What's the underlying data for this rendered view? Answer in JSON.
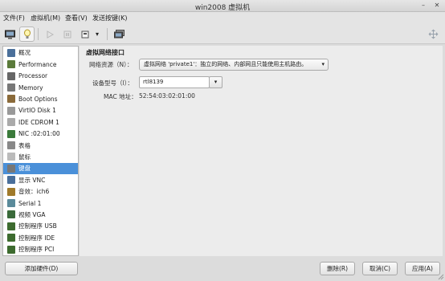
{
  "window": {
    "title": "win2008 虚拟机"
  },
  "menubar": [
    "文件(F)",
    "虚拟机(M)",
    "查看(V)",
    "发送按键(K)"
  ],
  "toolbar": {
    "buttons": [
      "console-icon",
      "info-icon",
      "run-icon",
      "pause-icon",
      "shutdown-icon",
      "dropdown-arrow-icon",
      "snapshot-icon"
    ],
    "dropdown_glyph": "▾"
  },
  "sidebar": {
    "selected_index": 10,
    "items": [
      {
        "label": "概况",
        "icon": "overview-icon"
      },
      {
        "label": "Performance",
        "icon": "performance-icon"
      },
      {
        "label": "Processor",
        "icon": "processor-icon"
      },
      {
        "label": "Memory",
        "icon": "memory-icon"
      },
      {
        "label": "Boot Options",
        "icon": "boot-options-icon"
      },
      {
        "label": "VirtIO Disk 1",
        "icon": "disk-icon"
      },
      {
        "label": "IDE CDROM 1",
        "icon": "cdrom-icon"
      },
      {
        "label": "NIC :02:01:00",
        "icon": "nic-icon"
      },
      {
        "label": "表格",
        "icon": "tablet-icon"
      },
      {
        "label": "鼠标",
        "icon": "mouse-icon"
      },
      {
        "label": "键盘",
        "icon": "keyboard-icon"
      },
      {
        "label": "显示 VNC",
        "icon": "display-icon"
      },
      {
        "label": "音效：ich6",
        "icon": "sound-icon"
      },
      {
        "label": "Serial 1",
        "icon": "serial-icon"
      },
      {
        "label": "视频 VGA",
        "icon": "video-icon"
      },
      {
        "label": "控制程序 USB",
        "icon": "controller-icon"
      },
      {
        "label": "控制程序 IDE",
        "icon": "controller-icon"
      },
      {
        "label": "控制程序 PCI",
        "icon": "controller-icon"
      }
    ]
  },
  "details": {
    "section_title": "虚拟网络接口",
    "network_source_label": "网络资源（N）：",
    "network_source_value": "虚拟网络 'private1'：独立的网络、内部网且只能使用主机路由。",
    "device_model_label": "设备型号（l）：",
    "device_model_value": "rtl8139",
    "mac_label": "MAC 地址：",
    "mac_value": "52:54:03:02:01:00"
  },
  "buttons": {
    "add_hardware": "添加硬件(D)",
    "remove": "删除(R)",
    "cancel": "取消(C)",
    "apply": "应用(A)"
  },
  "colors": {
    "selection": "#4a90d9"
  }
}
